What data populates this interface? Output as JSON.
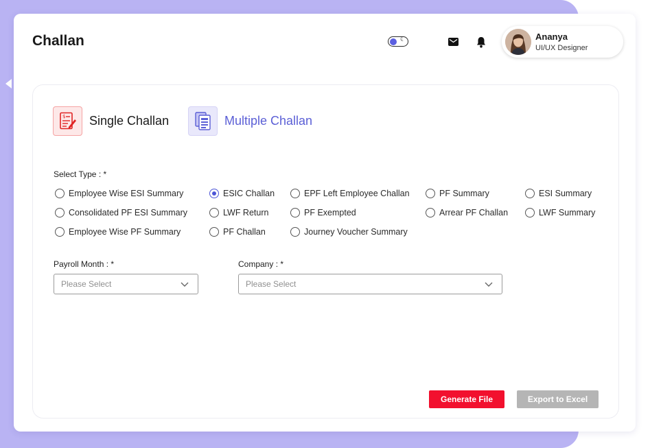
{
  "header": {
    "title": "Challan",
    "user": {
      "name": "Ananya",
      "role": "UI/UX Designer"
    },
    "icons": {
      "theme": "theme-toggle-icon",
      "mail": "mail-icon",
      "notifications": "bell-icon"
    }
  },
  "tabs": [
    {
      "label": "Single Challan",
      "icon": "single-challan-icon",
      "color": "#1a1a1a"
    },
    {
      "label": "Multiple Challan",
      "icon": "multiple-challan-icon",
      "color": "#5b5fd6"
    }
  ],
  "select_type": {
    "label": "Select Type : *",
    "selected": "ESIC Challan",
    "options": [
      "Employee Wise ESI Summary",
      "ESIC Challan",
      "EPF Left Employee Challan",
      "PF Summary",
      "ESI Summary",
      "Consolidated PF ESI Summary",
      "LWF Return",
      "PF Exempted",
      "Arrear PF Challan",
      "LWF Summary",
      "Employee Wise PF Summary",
      "PF Challan",
      "Journey Voucher Summary"
    ]
  },
  "payroll_month": {
    "label": "Payroll Month : *",
    "placeholder": "Please Select"
  },
  "company": {
    "label": "Company : *",
    "placeholder": "Please Select"
  },
  "actions": {
    "generate": "Generate File",
    "export": "Export to Excel"
  },
  "colors": {
    "accent": "#5b5fd6",
    "danger": "#f2102e",
    "disabled": "#b5b5b5",
    "backdrop": "#b9b3f3"
  }
}
